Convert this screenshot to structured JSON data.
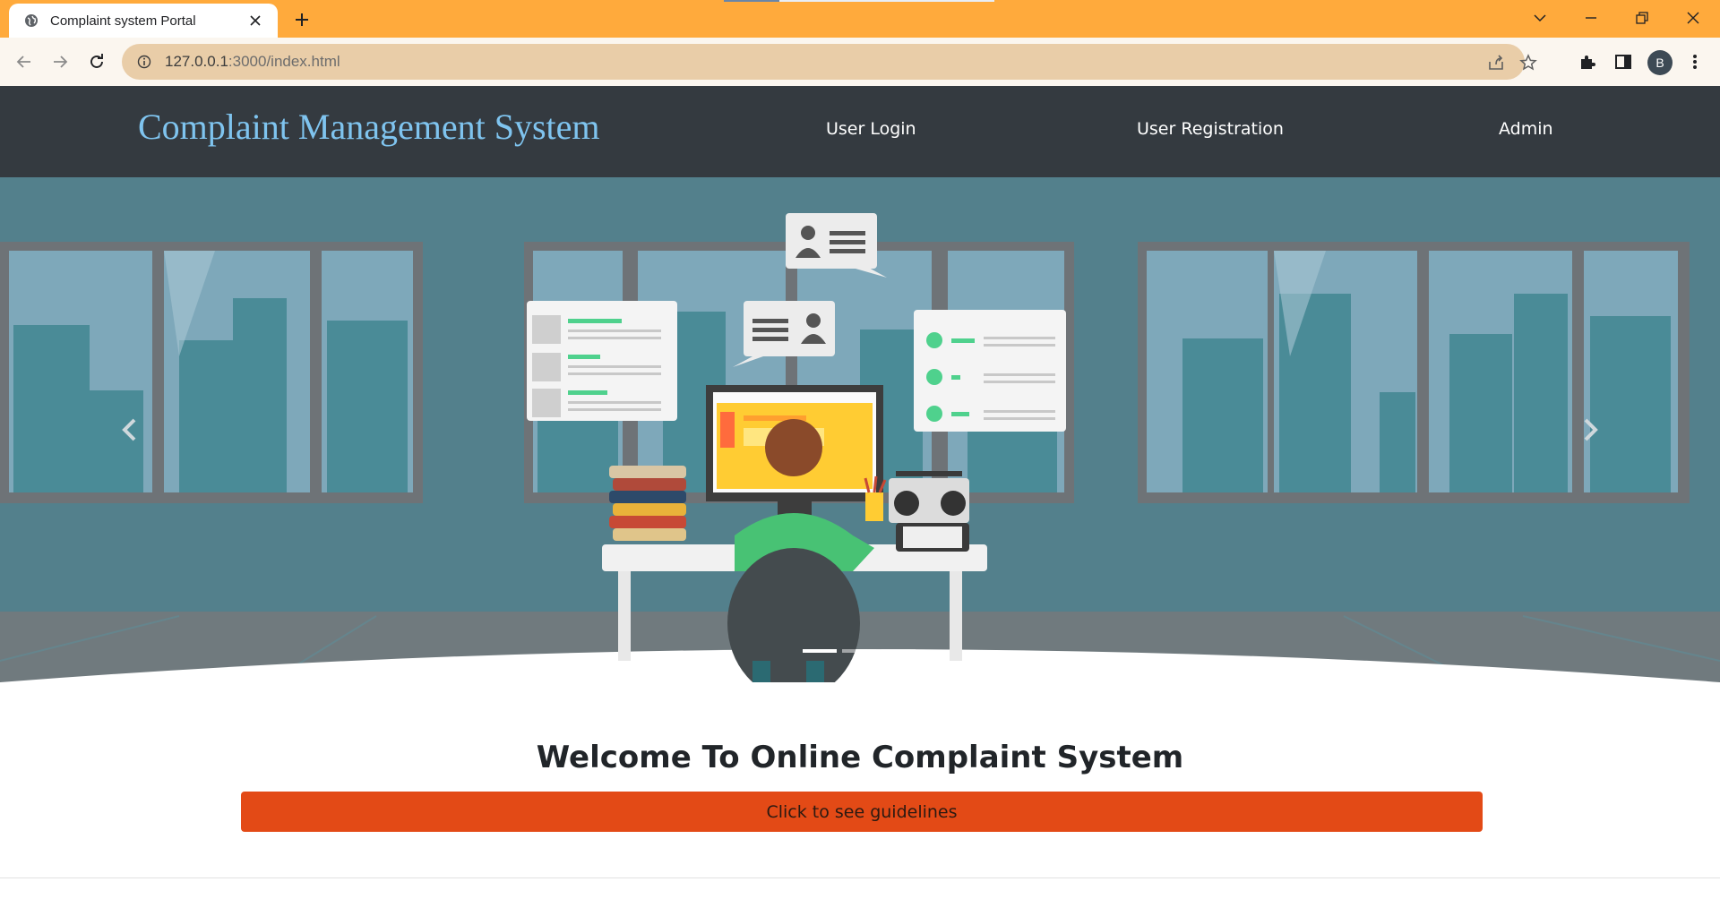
{
  "browser": {
    "tab_title": "Complaint system Portal",
    "url_host": "127.0.0.1",
    "url_path": ":3000/index.html",
    "profile_initial": "B",
    "colors": {
      "frame": "#ffaa3c",
      "omnibox": "#e9cda8"
    },
    "icons": [
      "globe-icon",
      "close-icon",
      "plus-icon",
      "chevron-down-icon",
      "minimize-icon",
      "restore-icon",
      "close-window-icon",
      "back-icon",
      "forward-icon",
      "reload-icon",
      "info-icon",
      "share-icon",
      "star-icon",
      "extensions-icon",
      "side-panel-icon",
      "more-icon"
    ]
  },
  "site": {
    "brand": "Complaint Management System",
    "nav": {
      "user_login": "User Login",
      "user_registration": "User Registration",
      "admin": "Admin"
    },
    "colors": {
      "navbar": "#343a40",
      "brand": "#7fc4ef",
      "button": "#e34a16"
    }
  },
  "carousel": {
    "indicator_count": 3,
    "active_index": 0
  },
  "main": {
    "heading": "Welcome To Online Complaint System",
    "guidelines_button": "Click to see guidelines"
  }
}
